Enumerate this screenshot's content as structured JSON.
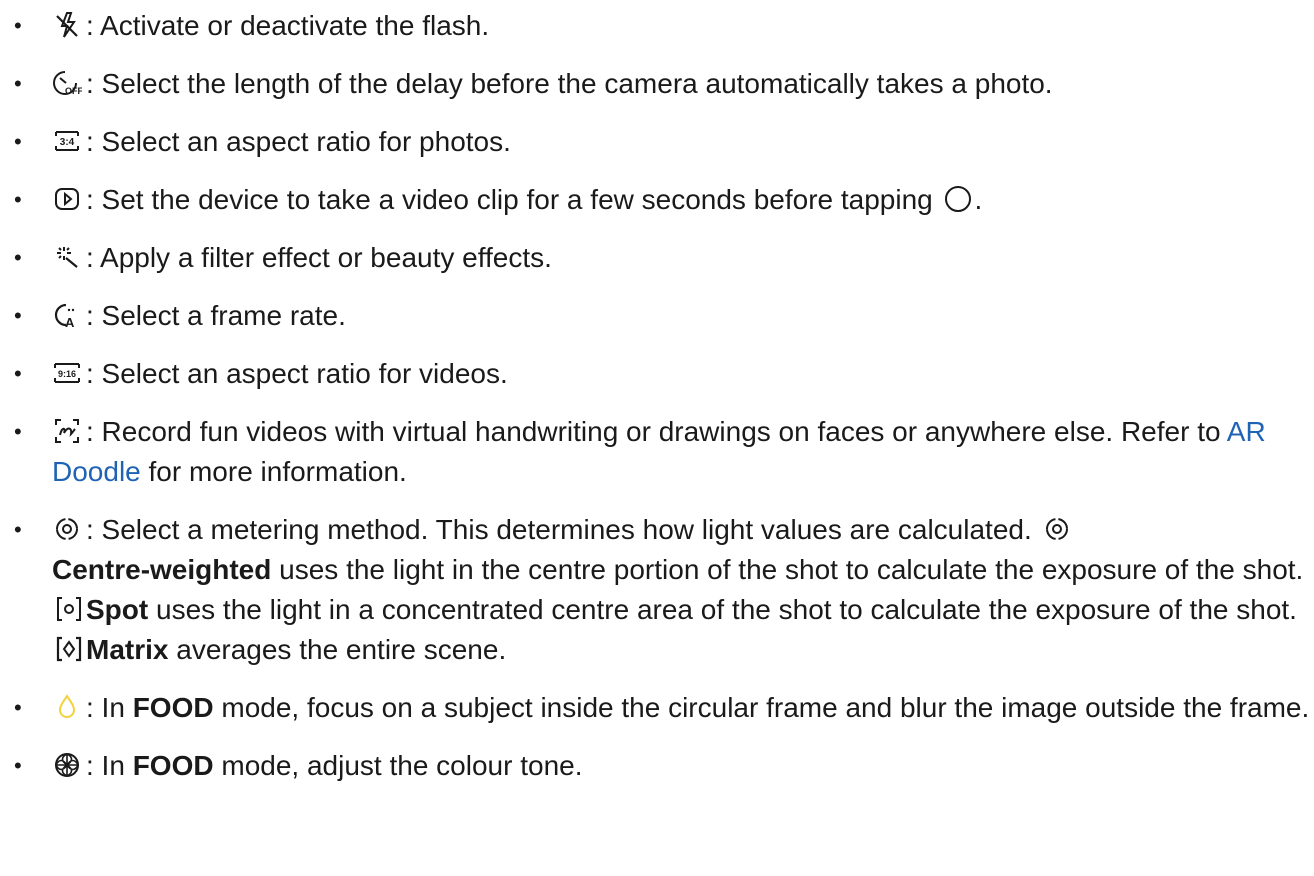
{
  "items": [
    {
      "icon": "flash-off-icon",
      "text": ": Activate or deactivate the flash."
    },
    {
      "icon": "timer-off-icon",
      "text": ": Select the length of the delay before the camera automatically takes a photo."
    },
    {
      "icon": "aspect-ratio-3-4-icon",
      "icon_text": "3:4",
      "text": ": Select an aspect ratio for photos."
    },
    {
      "icon": "motion-photo-icon",
      "text_a": ": Set the device to take a video clip for a few seconds before tapping ",
      "inline_icon": "shutter-button-icon",
      "text_b": "."
    },
    {
      "icon": "filters-icon",
      "text": ": Apply a filter effect or beauty effects."
    },
    {
      "icon": "frame-rate-auto-icon",
      "text": ": Select a frame rate."
    },
    {
      "icon": "aspect-ratio-9-16-icon",
      "icon_text": "9:16",
      "text": ": Select an aspect ratio for videos."
    },
    {
      "icon": "ar-doodle-icon",
      "text_a": ": Record fun videos with virtual handwriting or drawings on faces or anywhere else. Refer to ",
      "link": "AR Doodle",
      "text_b": " for more information."
    },
    {
      "icon": "metering-centre-icon",
      "text_a": ": Select a metering method. This determines how light values are calculated. ",
      "bold_1": "Centre-weighted",
      "text_b": " uses the light in the centre portion of the shot to calculate the exposure of the shot. ",
      "bold_2": "Spot",
      "text_c": " uses the light in a concentrated centre area of the shot to calculate the exposure of the shot. ",
      "bold_3": "Matrix",
      "text_d": " averages the entire scene."
    },
    {
      "icon": "food-focus-icon",
      "text_a": ": In ",
      "bold": "FOOD",
      "text_b": " mode, focus on a subject inside the circular frame and blur the image outside the frame."
    },
    {
      "icon": "colour-tone-icon",
      "text_a": ": In ",
      "bold": "FOOD",
      "text_b": " mode, adjust the colour tone."
    }
  ],
  "bullet": "•",
  "colors": {
    "text": "#1a1a1a",
    "link": "#1f63b4",
    "food_icon": "#f2d23c"
  }
}
